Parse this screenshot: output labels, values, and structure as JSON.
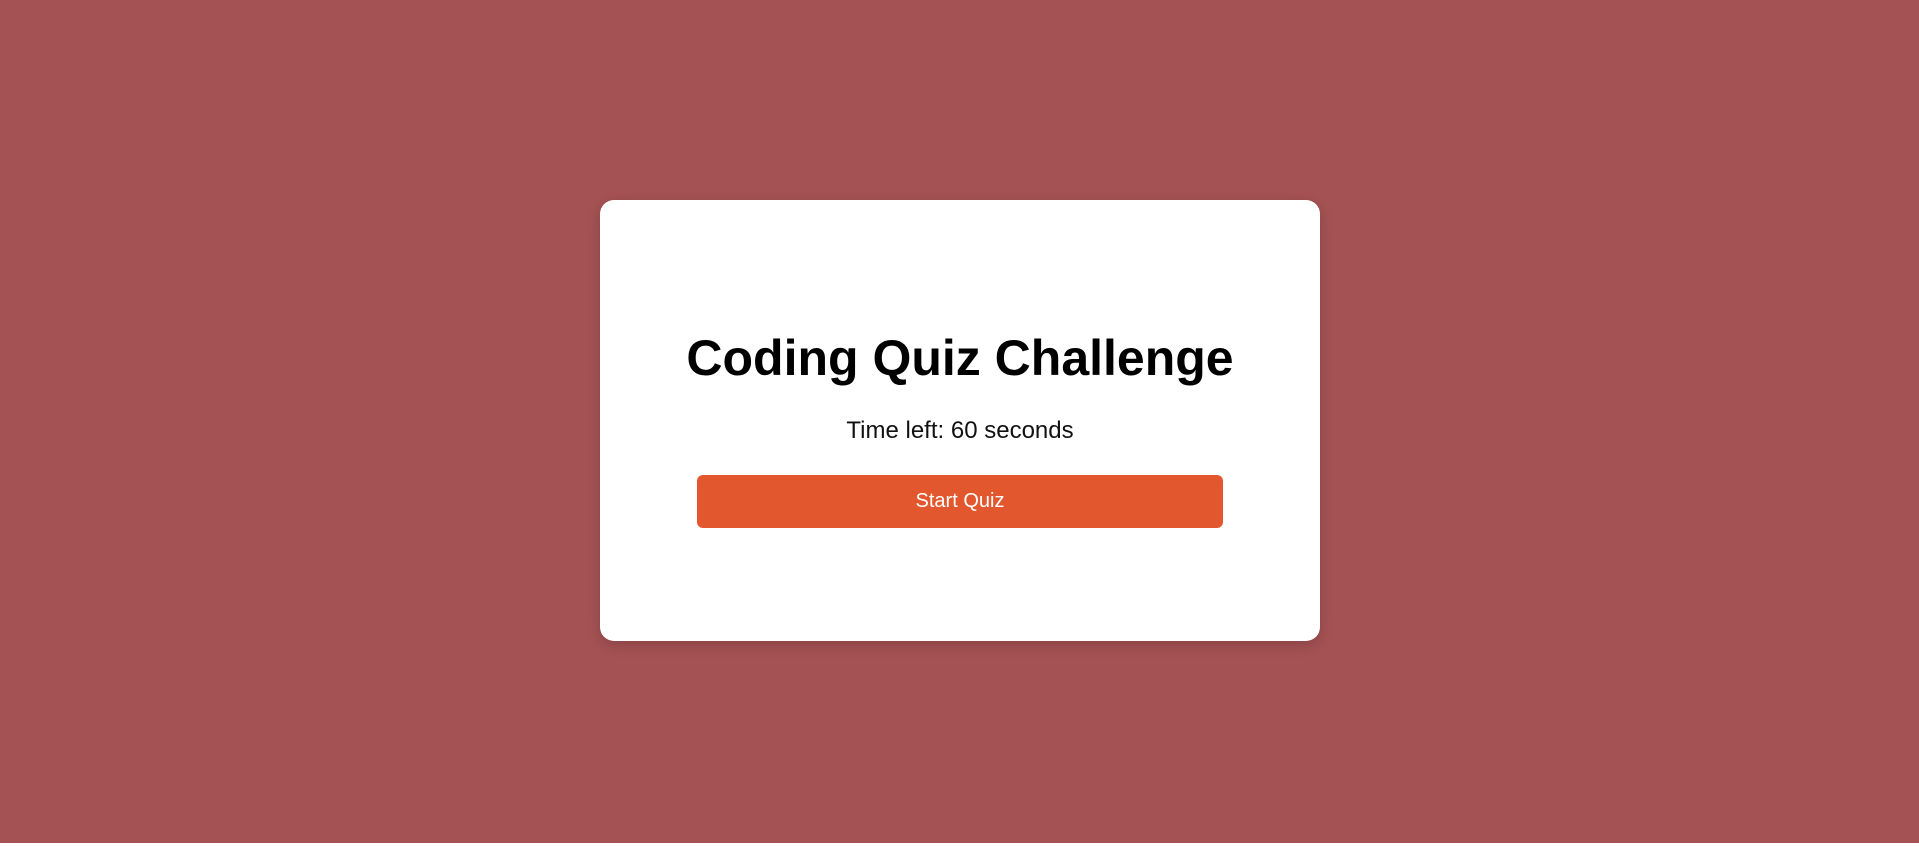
{
  "colors": {
    "page_background": "#a55254",
    "card_background": "#ffffff",
    "button_background": "#e3572e",
    "button_text": "#ffffff",
    "title_text": "#000000"
  },
  "quiz": {
    "title": "Coding Quiz Challenge",
    "timer_text": "Time left: 60 seconds",
    "start_button_label": "Start Quiz"
  }
}
